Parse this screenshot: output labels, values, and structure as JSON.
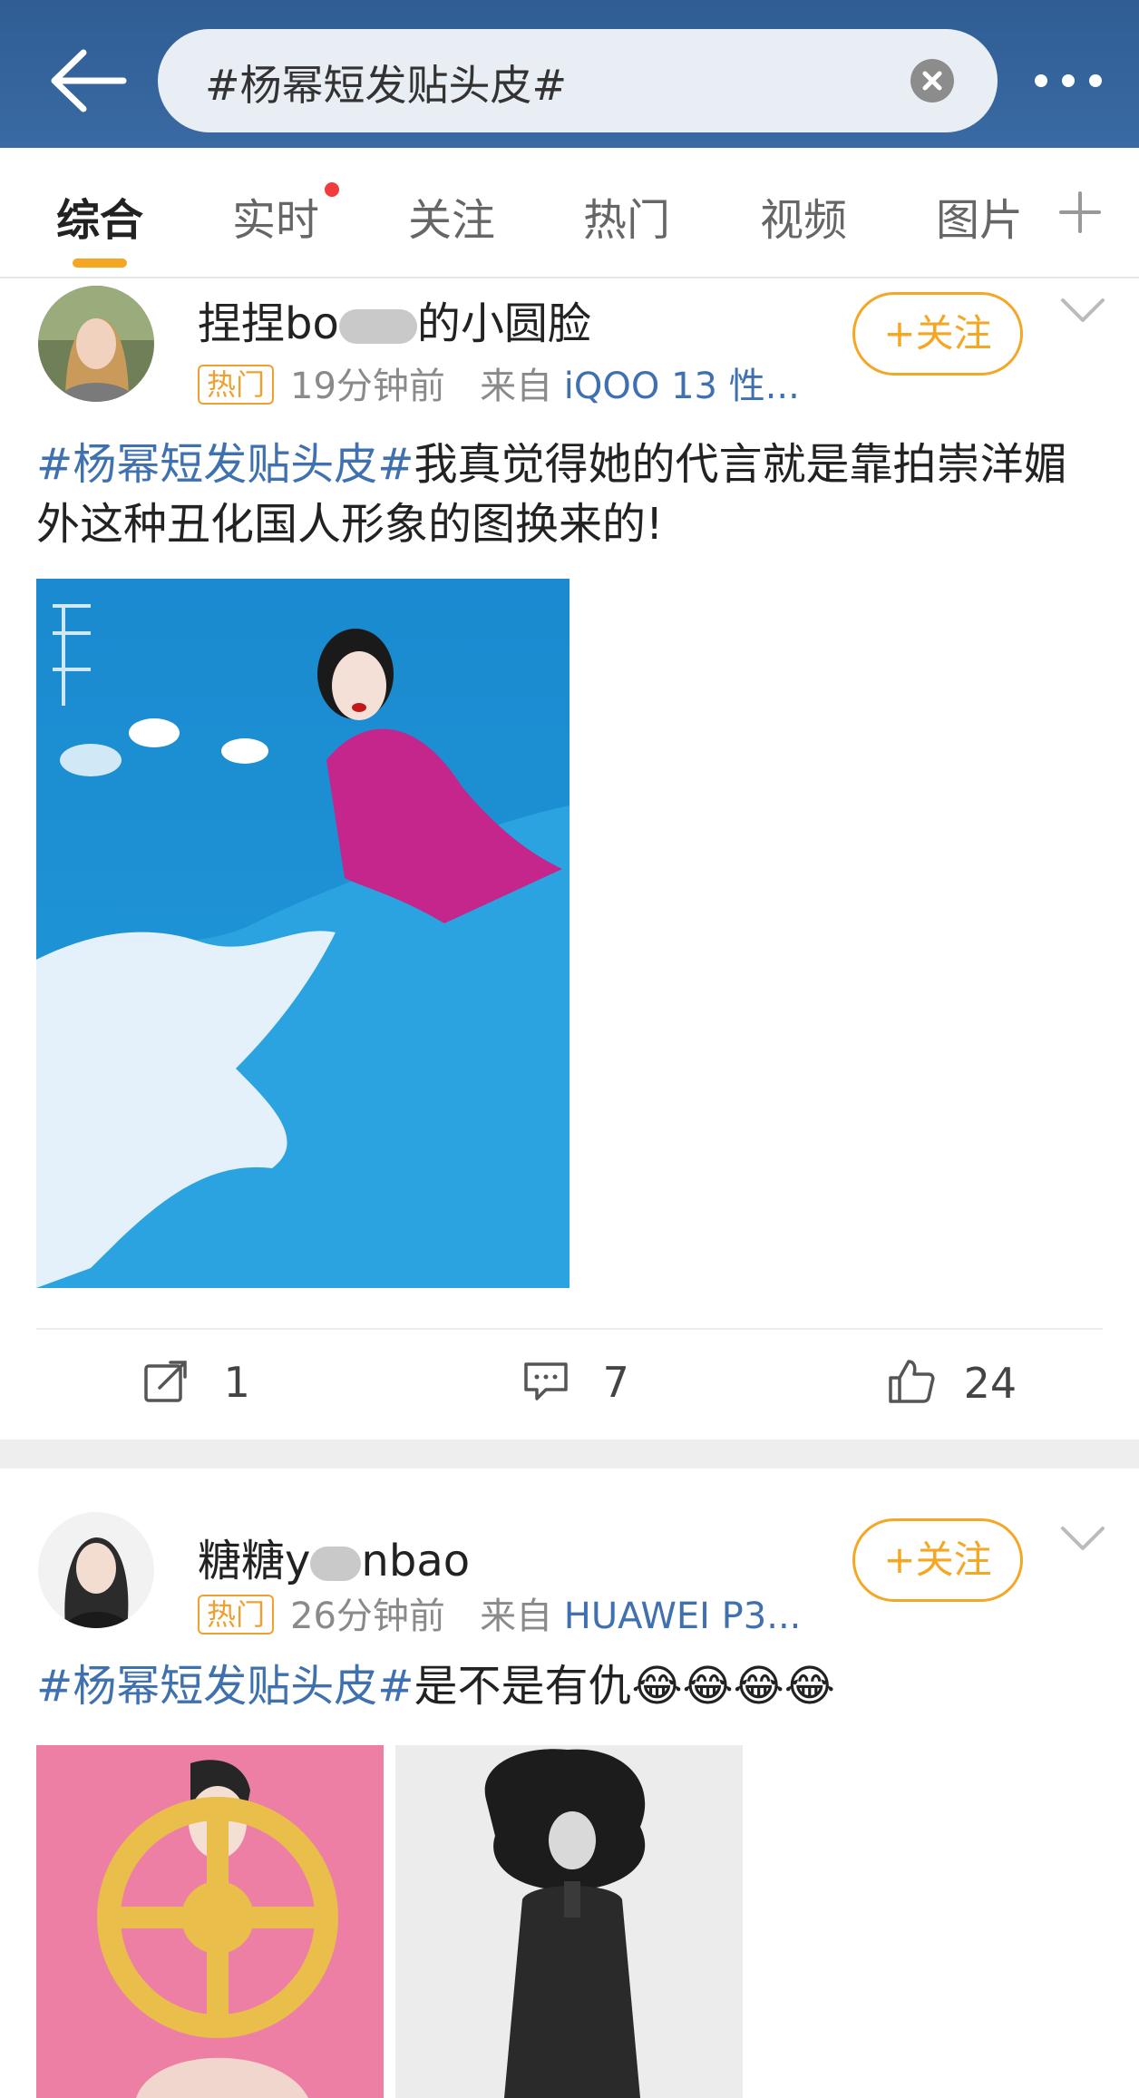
{
  "search": {
    "query": "#杨幂短发贴头皮#"
  },
  "tabs": [
    {
      "label": "综合"
    },
    {
      "label": "实时"
    },
    {
      "label": "关注"
    },
    {
      "label": "热门"
    },
    {
      "label": "视频"
    },
    {
      "label": "图片"
    }
  ],
  "posts": [
    {
      "username_a": "捏捏bo",
      "username_b": "的小圆脸",
      "hot_badge": "热门",
      "time": "19分钟前",
      "source_prefix": "来自",
      "source": "iQOO 13 性...",
      "follow_label": "+关注",
      "tag": "#杨幂短发贴头皮#",
      "text": "我真觉得她的代言就是靠拍崇洋媚外这种丑化国人形象的图换来的!",
      "actions": {
        "repost": "1",
        "comments": "7",
        "likes": "24"
      }
    },
    {
      "username_a": "糖糖y",
      "username_b": "nbao",
      "hot_badge": "热门",
      "time": "26分钟前",
      "source_prefix": "来自",
      "source": "HUAWEI P3...",
      "follow_label": "+关注",
      "tag": "#杨幂短发贴头皮#",
      "text": "是不是有仇",
      "emoji": "😂😂😂😂"
    }
  ],
  "colors": {
    "accent": "#f5a623",
    "link": "#3f71b1",
    "header": "#2f5d94"
  }
}
